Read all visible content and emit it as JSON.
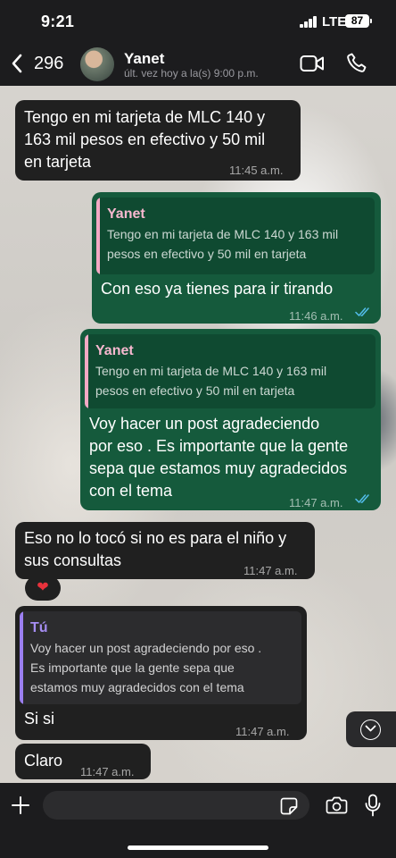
{
  "status_bar": {
    "time": "9:21",
    "network": "LTE",
    "battery": "87"
  },
  "header": {
    "unread_count": "296",
    "contact_name": "Yanet",
    "last_seen": "últ. vez hoy a la(s) 9:00 p.m."
  },
  "messages": [
    {
      "direction": "incoming",
      "lines": [
        "Tengo en mi tarjeta de MLC 140 y",
        "163 mil pesos en efectivo y 50 mil",
        "en tarjeta"
      ],
      "time": "11:45 a.m."
    },
    {
      "direction": "outgoing",
      "quote": {
        "author": "Yanet",
        "lines": [
          "Tengo en mi tarjeta de MLC 140 y 163 mil",
          "pesos en efectivo y 50 mil en tarjeta"
        ]
      },
      "lines": [
        "Con eso ya tienes para ir tirando"
      ],
      "time": "11:46 a.m.",
      "status": "read"
    },
    {
      "direction": "outgoing",
      "quote": {
        "author": "Yanet",
        "lines": [
          "Tengo en mi tarjeta de MLC 140 y 163 mil",
          "pesos en efectivo y 50 mil en tarjeta"
        ]
      },
      "lines": [
        "Voy hacer un post agradeciendo",
        "por eso . Es importante que la gente",
        "sepa que estamos muy agradecidos",
        "con el tema"
      ],
      "time": "11:47 a.m.",
      "status": "read"
    },
    {
      "direction": "incoming",
      "lines": [
        "Eso no lo tocó si no es para el niño y",
        "sus consultas"
      ],
      "time": "11:47 a.m.",
      "reaction": "heart-icon"
    },
    {
      "direction": "incoming",
      "quote": {
        "author": "Tú",
        "lines": [
          "Voy hacer un post agradeciendo por eso .",
          "Es importante que la gente sepa que",
          "estamos muy agradecidos con el tema"
        ]
      },
      "lines": [
        "Si si"
      ],
      "time": "11:47 a.m."
    },
    {
      "direction": "incoming",
      "lines": [
        "Claro"
      ],
      "time": "11:47 a.m."
    }
  ],
  "input": {
    "placeholder": ""
  },
  "icons": [
    "back-chevron-icon",
    "video-call-icon",
    "phone-icon",
    "heart-icon",
    "chevron-down-icon",
    "plus-icon",
    "sticker-icon",
    "camera-icon",
    "mic-icon"
  ],
  "colors": {
    "bar_background": "#1c1c1e",
    "incoming_bubble": "#202020",
    "outgoing_bubble": "#155a3c",
    "read_ticks": "#53bdeb",
    "quote_yanet_bar": "#f4a9c4",
    "quote_yanet_author": "#f6b8cf",
    "quote_tu_bar": "#9b7ff0",
    "quote_tu_author": "#a58df2",
    "heart": "#e8323c"
  }
}
